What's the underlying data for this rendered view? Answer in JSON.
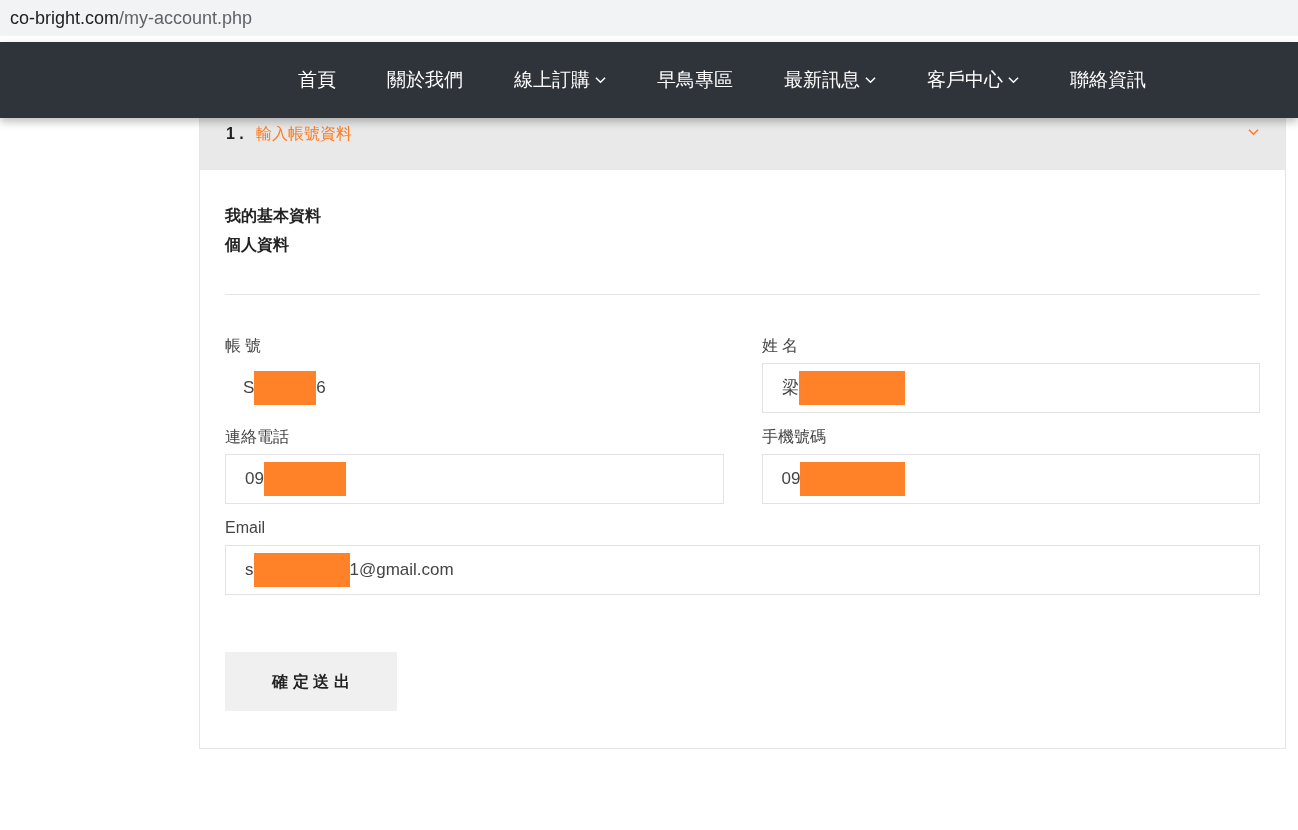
{
  "address_bar": {
    "domain": "co-bright.com",
    "path": "/my-account.php"
  },
  "nav": {
    "items": [
      {
        "label": "首頁",
        "dropdown": false
      },
      {
        "label": "關於我們",
        "dropdown": false
      },
      {
        "label": "線上訂購",
        "dropdown": true
      },
      {
        "label": "早鳥專區",
        "dropdown": false
      },
      {
        "label": "最新訊息",
        "dropdown": true
      },
      {
        "label": "客戶中心",
        "dropdown": true
      },
      {
        "label": "聯絡資訊",
        "dropdown": false
      }
    ]
  },
  "section": {
    "number": "1 .",
    "title": "輸入帳號資料",
    "expanded": true,
    "headings": [
      "我的基本資料",
      "個人資料"
    ],
    "fields": [
      {
        "label": "帳 號",
        "kind": "text",
        "value_before": "S",
        "redacted": true,
        "value_after": "6"
      },
      {
        "label": "姓 名",
        "kind": "input",
        "value_before": "梁",
        "redacted": true
      },
      {
        "label": "連絡電話",
        "kind": "input",
        "value_before": "09",
        "redacted": true
      },
      {
        "label": "手機號碼",
        "kind": "input",
        "value_before": "09",
        "redacted": true
      },
      {
        "label": "Email",
        "kind": "wide",
        "value_before": "s",
        "redacted": true,
        "value_after": "1@gmail.com"
      }
    ],
    "submit": "確 定 送 出"
  }
}
